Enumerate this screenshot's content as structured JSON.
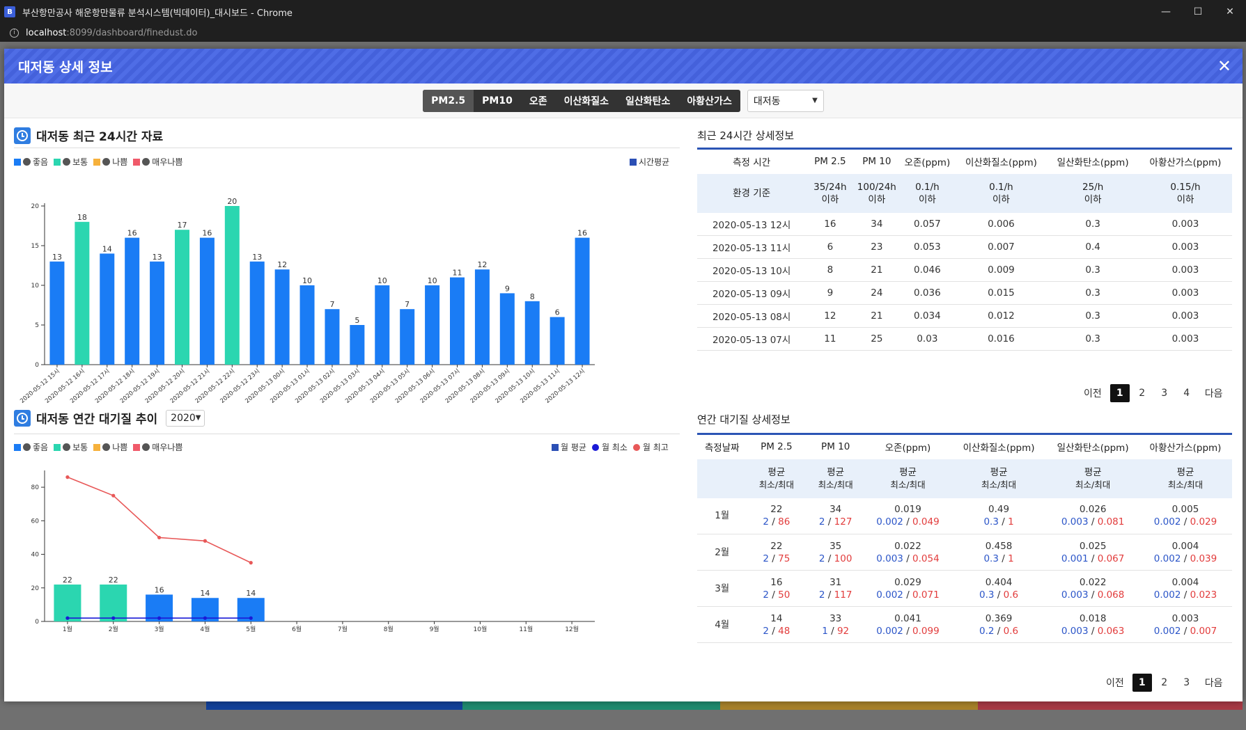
{
  "window": {
    "title": "부산항만공사 해운항만물류 분석시스템(빅데이터)_대시보드 - Chrome",
    "url_host": "localhost",
    "url_path": ":8099/dashboard/finedust.do",
    "minimize": "—",
    "maximize": "☐",
    "close": "✕"
  },
  "modal": {
    "title": "대저동 상세 정보",
    "close": "✕"
  },
  "toolbar": {
    "tabs": [
      "PM2.5",
      "PM10",
      "오존",
      "이산화질소",
      "일산화탄소",
      "아황산가스"
    ],
    "active_tab": "PM2.5",
    "region": "대저동"
  },
  "colors": {
    "good": "#1a7cf5",
    "normal": "#2bd6b0",
    "bad": "#f6b13c",
    "very_bad": "#f05a6a",
    "hourly_avg": "#2b4fb5",
    "monthly_min": "#1a1ad6",
    "monthly_max": "#e85858"
  },
  "legend": {
    "good": "좋음",
    "normal": "보통",
    "bad": "나쁨",
    "very_bad": "매우나쁨",
    "hourly_avg": "시간평균",
    "monthly_avg": "월 평균",
    "monthly_min": "월 최소",
    "monthly_max": "월 최고"
  },
  "hourly_panel": {
    "title": "대저동 최근 24시간 자료"
  },
  "yearly_panel": {
    "title": "대저동 연간 대기질 추이",
    "year": "2020"
  },
  "chart_data": [
    {
      "type": "bar",
      "categories": [
        "2020-05-12 15시",
        "2020-05-12 16시",
        "2020-05-12 17시",
        "2020-05-12 18시",
        "2020-05-12 19시",
        "2020-05-12 20시",
        "2020-05-12 21시",
        "2020-05-12 22시",
        "2020-05-12 23시",
        "2020-05-13 00시",
        "2020-05-13 01시",
        "2020-05-13 02시",
        "2020-05-13 03시",
        "2020-05-13 04시",
        "2020-05-13 05시",
        "2020-05-13 06시",
        "2020-05-13 07시",
        "2020-05-13 08시",
        "2020-05-13 09시",
        "2020-05-13 10시",
        "2020-05-13 11시",
        "2020-05-13 12시"
      ],
      "values": [
        13,
        18,
        14,
        16,
        13,
        17,
        16,
        20,
        13,
        12,
        10,
        7,
        5,
        10,
        7,
        10,
        11,
        12,
        9,
        8,
        6,
        16
      ],
      "levels": [
        "good",
        "normal",
        "good",
        "good",
        "good",
        "normal",
        "good",
        "normal",
        "good",
        "good",
        "good",
        "good",
        "good",
        "good",
        "good",
        "good",
        "good",
        "good",
        "good",
        "good",
        "good",
        "good"
      ],
      "ylim": [
        0,
        20
      ],
      "yticks": [
        0,
        5,
        10,
        15,
        20
      ],
      "legend_position": "top"
    },
    {
      "type": "bar",
      "categories": [
        "1월",
        "2월",
        "3월",
        "4월",
        "5월",
        "6월",
        "7월",
        "8월",
        "9월",
        "10월",
        "11월",
        "12월"
      ],
      "series": [
        {
          "name": "월 평균",
          "values": [
            22,
            22,
            16,
            14,
            14,
            null,
            null,
            null,
            null,
            null,
            null,
            null
          ],
          "levels": [
            "normal",
            "normal",
            "good",
            "good",
            "good"
          ]
        },
        {
          "name": "월 최소",
          "values": [
            2,
            2,
            2,
            2,
            2,
            null,
            null,
            null,
            null,
            null,
            null,
            null
          ]
        },
        {
          "name": "월 최고",
          "values": [
            86,
            75,
            50,
            48,
            35,
            null,
            null,
            null,
            null,
            null,
            null,
            null
          ]
        }
      ],
      "ylim": [
        0,
        90
      ],
      "yticks": [
        0,
        20,
        40,
        60,
        80
      ],
      "legend_position": "top"
    }
  ],
  "recent_table": {
    "title": "최근 24시간 상세정보",
    "headers": [
      "측정 시간",
      "PM 2.5",
      "PM 10",
      "오존(ppm)",
      "이산화질소(ppm)",
      "일산화탄소(ppm)",
      "아황산가스(ppm)"
    ],
    "standard_label": "환경 기준",
    "standards": [
      [
        "35/24h",
        "이하"
      ],
      [
        "100/24h",
        "이하"
      ],
      [
        "0.1/h",
        "이하"
      ],
      [
        "0.1/h",
        "이하"
      ],
      [
        "25/h",
        "이하"
      ],
      [
        "0.15/h",
        "이하"
      ]
    ],
    "rows": [
      [
        "2020-05-13 12시",
        "16",
        "34",
        "0.057",
        "0.006",
        "0.3",
        "0.003"
      ],
      [
        "2020-05-13 11시",
        "6",
        "23",
        "0.053",
        "0.007",
        "0.4",
        "0.003"
      ],
      [
        "2020-05-13 10시",
        "8",
        "21",
        "0.046",
        "0.009",
        "0.3",
        "0.003"
      ],
      [
        "2020-05-13 09시",
        "9",
        "24",
        "0.036",
        "0.015",
        "0.3",
        "0.003"
      ],
      [
        "2020-05-13 08시",
        "12",
        "21",
        "0.034",
        "0.012",
        "0.3",
        "0.003"
      ],
      [
        "2020-05-13 07시",
        "11",
        "25",
        "0.03",
        "0.016",
        "0.3",
        "0.003"
      ]
    ],
    "pager": {
      "prev": "이전",
      "pages": [
        "1",
        "2",
        "3",
        "4"
      ],
      "active": "1",
      "next": "다음"
    }
  },
  "annual_table": {
    "title": "연간 대기질 상세정보",
    "headers": [
      "측정날짜",
      "PM 2.5",
      "PM 10",
      "오존(ppm)",
      "이산화질소(ppm)",
      "일산화탄소(ppm)",
      "아황산가스(ppm)"
    ],
    "sub_header": [
      "평균",
      "최소/최대"
    ],
    "sep": "/",
    "rows": [
      {
        "month": "1월",
        "cells": [
          [
            "22",
            "2",
            "86"
          ],
          [
            "34",
            "2",
            "127"
          ],
          [
            "0.019",
            "0.002",
            "0.049"
          ],
          [
            "0.49",
            "0.3",
            "1"
          ],
          [
            "0.026",
            "0.003",
            "0.081"
          ],
          [
            "0.005",
            "0.002",
            "0.029"
          ]
        ]
      },
      {
        "month": "2월",
        "cells": [
          [
            "22",
            "2",
            "75"
          ],
          [
            "35",
            "2",
            "100"
          ],
          [
            "0.022",
            "0.003",
            "0.054"
          ],
          [
            "0.458",
            "0.3",
            "1"
          ],
          [
            "0.025",
            "0.001",
            "0.067"
          ],
          [
            "0.004",
            "0.002",
            "0.039"
          ]
        ]
      },
      {
        "month": "3월",
        "cells": [
          [
            "16",
            "2",
            "50"
          ],
          [
            "31",
            "2",
            "117"
          ],
          [
            "0.029",
            "0.002",
            "0.071"
          ],
          [
            "0.404",
            "0.3",
            "0.6"
          ],
          [
            "0.022",
            "0.003",
            "0.068"
          ],
          [
            "0.004",
            "0.002",
            "0.023"
          ]
        ]
      },
      {
        "month": "4월",
        "cells": [
          [
            "14",
            "2",
            "48"
          ],
          [
            "33",
            "1",
            "92"
          ],
          [
            "0.041",
            "0.002",
            "0.099"
          ],
          [
            "0.369",
            "0.2",
            "0.6"
          ],
          [
            "0.018",
            "0.003",
            "0.063"
          ],
          [
            "0.003",
            "0.002",
            "0.007"
          ]
        ]
      }
    ],
    "pager": {
      "prev": "이전",
      "pages": [
        "1",
        "2",
        "3"
      ],
      "active": "1",
      "next": "다음"
    }
  }
}
